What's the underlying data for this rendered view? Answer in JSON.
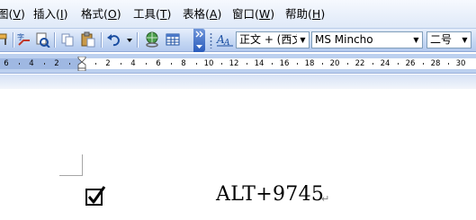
{
  "menubar": {
    "items": [
      {
        "label": "图",
        "key": "V"
      },
      {
        "label": "插入",
        "key": "I"
      },
      {
        "label": "格式",
        "key": "O"
      },
      {
        "label": "工具",
        "key": "T"
      },
      {
        "label": "表格",
        "key": "A"
      },
      {
        "label": "窗口",
        "key": "W"
      },
      {
        "label": "帮助",
        "key": "H"
      }
    ]
  },
  "toolbar": {
    "style_combo": "正文 + (西文",
    "font_combo": "MS Mincho",
    "size_combo": "二号",
    "icons": [
      "format-painter-icon",
      "research-icon",
      "copy-icon",
      "paste-icon",
      "undo-icon",
      "hyperlink-icon",
      "table-icon",
      "styles-formatting-icon"
    ]
  },
  "ruler": {
    "left_numbers": [
      "6",
      "4",
      "2"
    ],
    "right_numbers": [
      "2",
      "4",
      "6",
      "8",
      "10",
      "12",
      "14",
      "16",
      "18",
      "20",
      "22",
      "24",
      "26",
      "28",
      "30"
    ]
  },
  "document": {
    "symbol": "☑",
    "text": "ALT+9745",
    "paragraph_mark": "↵"
  },
  "colors": {
    "toolbar_blue": "#c4d7f3",
    "ruler_blue": "#bcd0ef",
    "accent": "#2a5cbd"
  }
}
